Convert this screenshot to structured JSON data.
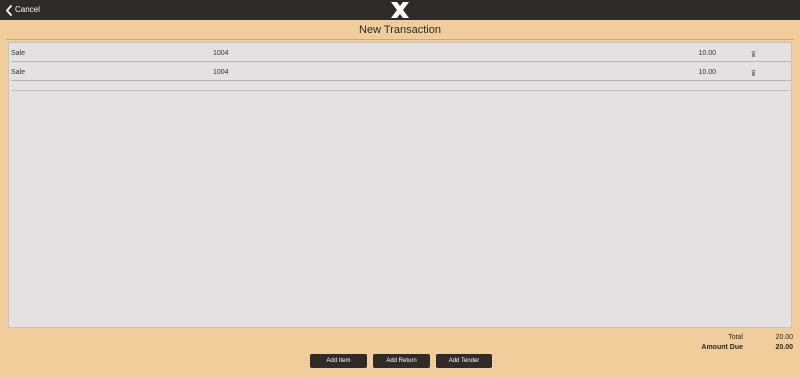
{
  "header": {
    "cancel_label": "Cancel",
    "logo_icon": "x-logo-icon",
    "background": "#2f2b29"
  },
  "page": {
    "title": "New Transaction",
    "background": "#f0cd9a"
  },
  "transaction_lines": [
    {
      "type": "Sale",
      "code": "1004",
      "amount": "10.00",
      "action_icon": "trash-icon"
    },
    {
      "type": "Sale",
      "code": "1004",
      "amount": "10.00",
      "action_icon": "trash-icon"
    }
  ],
  "totals": {
    "total_label": "Total",
    "total_value": "20.00",
    "amount_due_label": "Amount Due",
    "amount_due_value": "20.00"
  },
  "actions": {
    "add_item": "Add Item",
    "add_return": "Add Return",
    "add_tender": "Add Tender"
  }
}
